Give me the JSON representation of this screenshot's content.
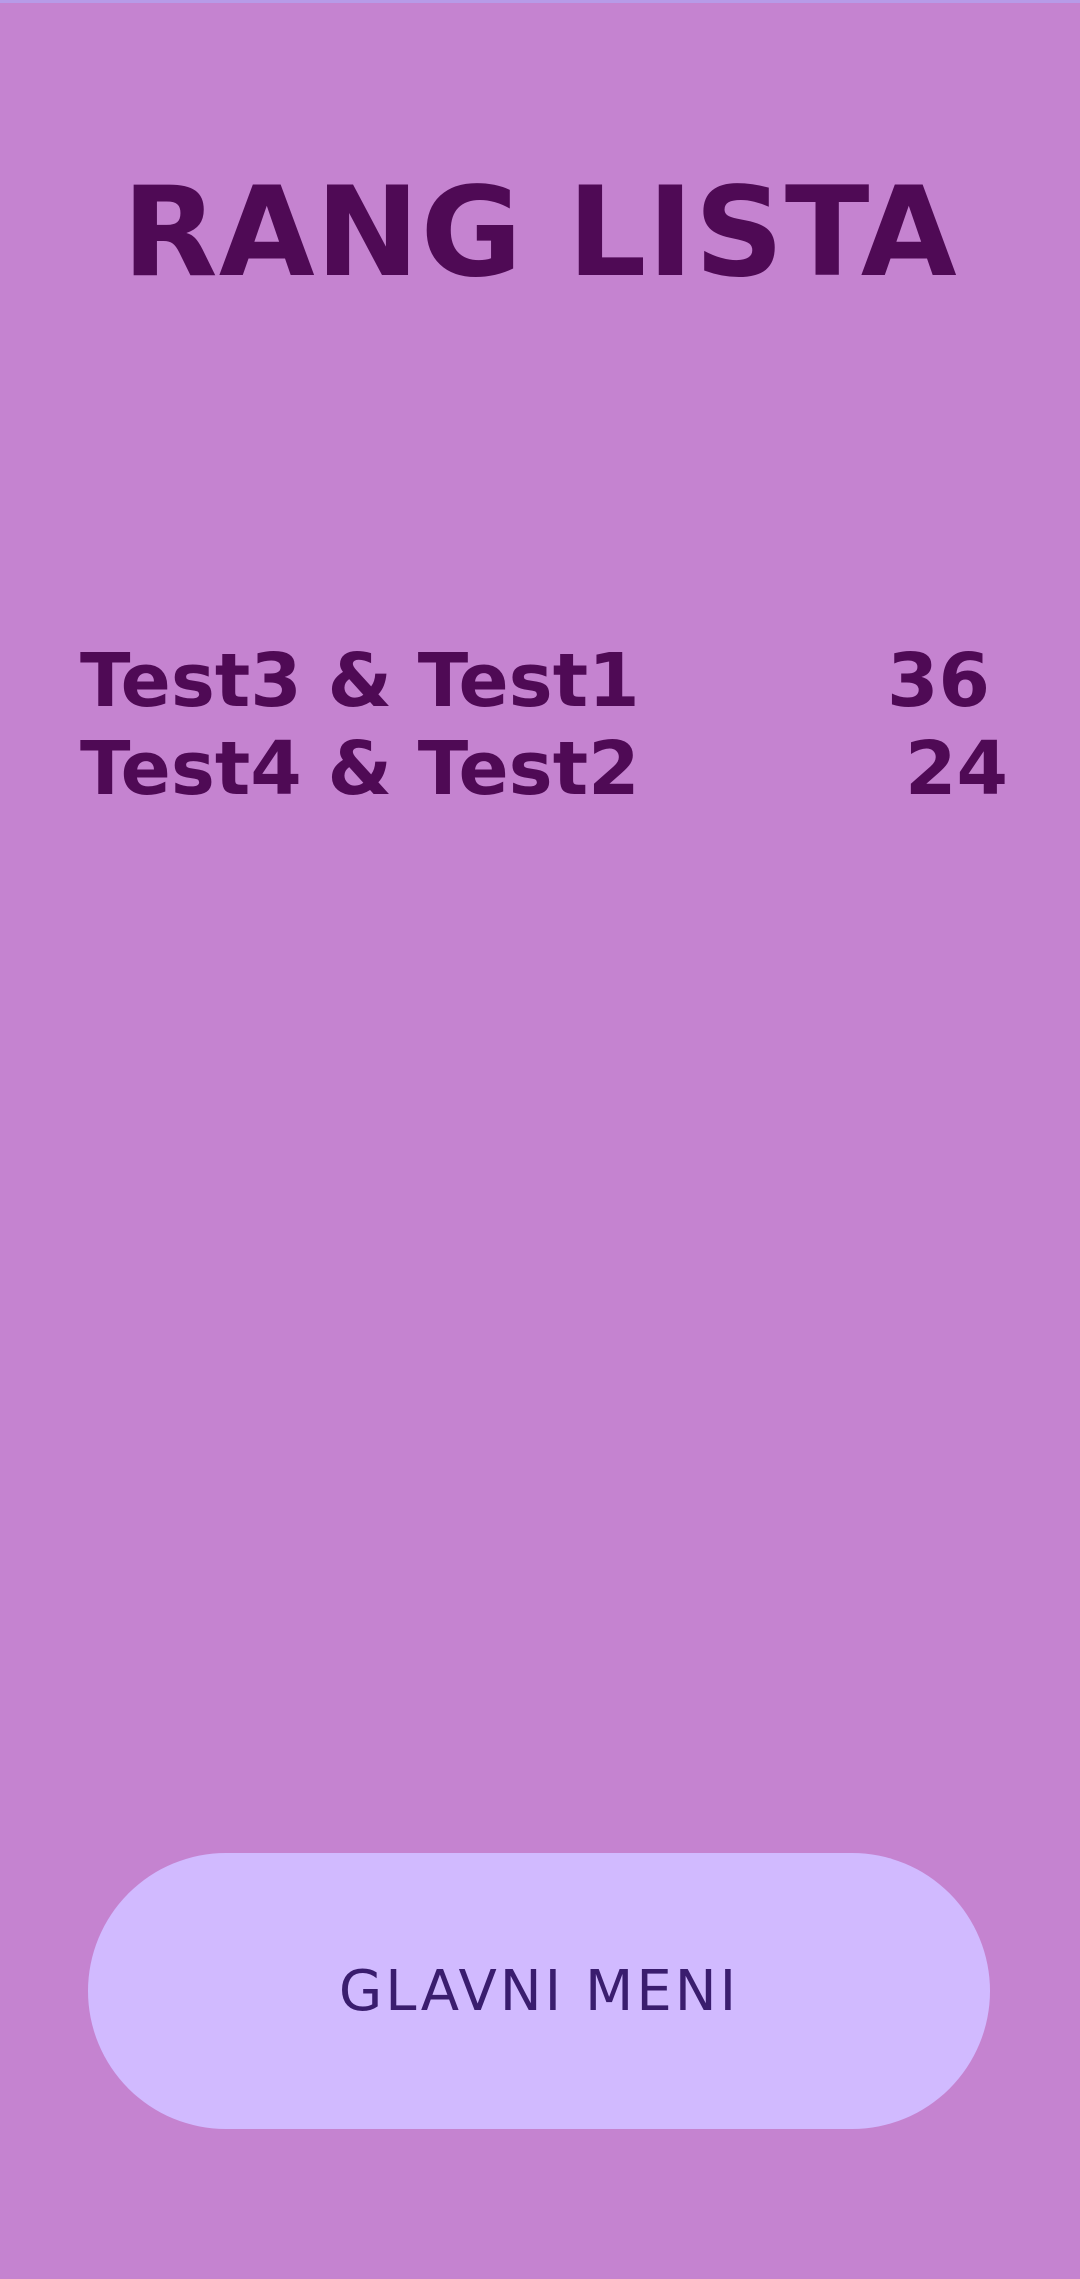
{
  "title": "RANG LISTA",
  "rankings": [
    {
      "pair": "Test3 & Test1",
      "score": "36"
    },
    {
      "pair": "Test4 & Test2",
      "score": "24"
    }
  ],
  "button": {
    "label": "GLAVNI MENI"
  },
  "colors": {
    "background": "#c583d0",
    "text": "#4f0a55",
    "button_background": "#d1baff",
    "button_text": "#3a1d6e"
  }
}
